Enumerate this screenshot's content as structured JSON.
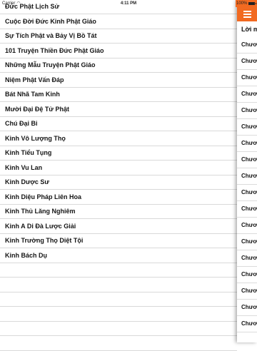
{
  "status_bar": {
    "carrier": "Carrier",
    "time": "4:11 PM",
    "battery": "100%"
  },
  "colors": {
    "accent": "#f26a21"
  },
  "list": {
    "items": [
      "Đức Phật Lịch Sử",
      "Cuộc Đời Đức Kinh Phật Giáo",
      "Sự Tích Phật và Bảy Vị Bồ Tát",
      "101 Truyện Thiền Đức Phật Giáo",
      "Những Mẫu Truyện Phật Giáo",
      "Niệm Phật Vấn Đáp",
      "Bát Nhã Tam Kinh",
      "Mười Đại Đệ Tử Phật",
      "Chú Đại Bi",
      "Kinh Vô Lượng Thọ",
      "Kinh Tiểu Tụng",
      "Kinh Vu Lan",
      "Kinh Dược Sư",
      "Kinh Diệu Pháp Liên Hoa",
      "Kinh Thủ Lăng Nghiêm",
      "Kinh A Di Đà Lược Giải",
      "Kinh Trường Thọ Diệt Tội",
      "Kinh Bách Dụ"
    ]
  },
  "side_panel": {
    "menu_icon": "hamburger-icon",
    "title": "Lời m",
    "chapters": [
      "Chươ",
      "Chươ",
      "Chươ",
      "Chươ",
      "Chươ",
      "Chươ",
      "Chươ",
      "Chươ",
      "Chươ",
      "Chươ",
      "Chươ",
      "Chươ",
      "Chươ",
      "Chươ",
      "Chươ",
      "Chươ",
      "Chươ",
      "Chươ"
    ]
  }
}
